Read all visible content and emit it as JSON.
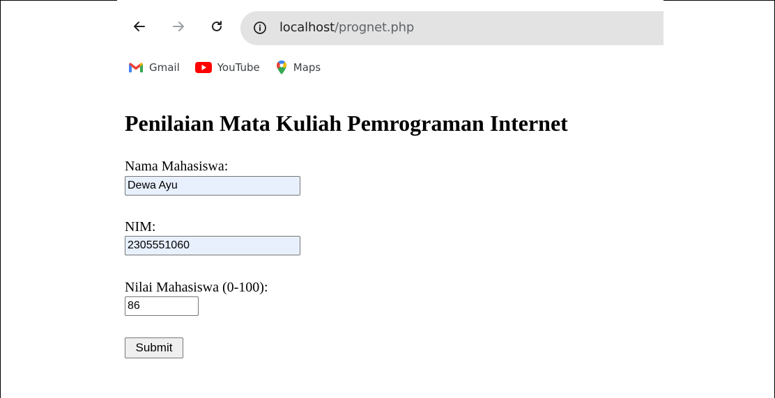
{
  "browser": {
    "url_host": "localhost",
    "url_path": "/prognet.php",
    "bookmarks": [
      {
        "label": "Gmail",
        "icon": "gmail-icon"
      },
      {
        "label": "YouTube",
        "icon": "youtube-icon"
      },
      {
        "label": "Maps",
        "icon": "maps-icon"
      }
    ]
  },
  "page": {
    "title": "Penilaian Mata Kuliah Pemrograman Internet",
    "form": {
      "name_label": "Nama Mahasiswa:",
      "name_value": "Dewa Ayu",
      "nim_label": "NIM:",
      "nim_value": "2305551060",
      "score_label": "Nilai Mahasiswa (0-100):",
      "score_value": "86",
      "submit_label": "Submit"
    }
  }
}
